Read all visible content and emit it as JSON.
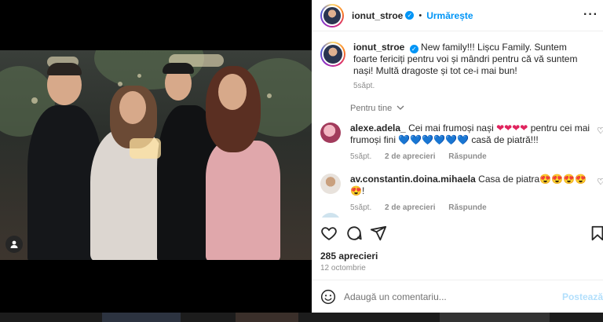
{
  "post": {
    "username": "ionut_stroe",
    "follow_label": "Urmărește",
    "dot": "•",
    "more_icon": "more-horizontal-icon"
  },
  "caption": {
    "username": "ionut_stroe",
    "text": "New family!!! Lișcu Family. Suntem foarte fericiți pentru voi și mândri pentru că vă suntem nași! Multă dragoste și tot ce-i mai bun!",
    "time": "5săpt."
  },
  "for_you_label": "Pentru tine",
  "comments": [
    {
      "username": "alexe.adela_",
      "text_before": "Cei mai frumoși nași",
      "emoji_before": "❤❤❤❤",
      "text_middle": "pentru cei mai frumoși fini",
      "emoji_middle": "💙💙💙💙💙💙",
      "text_after": "casă de piatră!!!",
      "time": "5săpt.",
      "likes": "2 de aprecieri",
      "reply_label": "Răspunde"
    },
    {
      "username": "av.constantin.doina.mihaela",
      "text": "Casa de piatra",
      "emoji": "😍😍😍😍😍",
      "suffix": "!",
      "time": "5săpt.",
      "likes": "2 de aprecieri",
      "reply_label": "Răspunde"
    }
  ],
  "likes_count": "285 aprecieri",
  "post_date": "12 octombrie",
  "comment_input": {
    "placeholder": "Adaugă un comentariu...",
    "post_label": "Postează"
  },
  "colors": {
    "accent": "#0095f6",
    "heart_red": "#e0245e",
    "heart_blue": "#1da1f2"
  }
}
